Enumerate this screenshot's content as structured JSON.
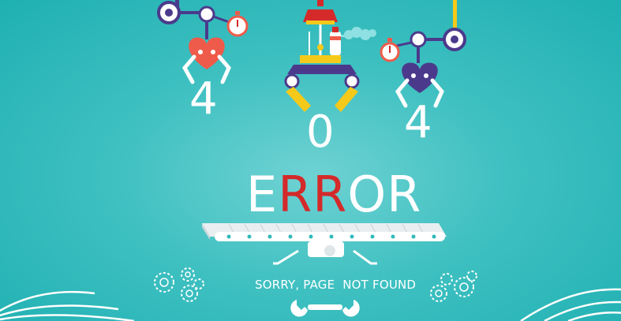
{
  "digits": {
    "first": "4",
    "second": "0",
    "third": "4"
  },
  "error_word": {
    "letters": [
      "E",
      "R",
      "R",
      "O",
      "R"
    ]
  },
  "message": "SORRY, PAGE  NOT FOUND",
  "colors": {
    "background": "#2fbabb",
    "white": "#ffffff",
    "red": "#d42a2a",
    "coral": "#ef5b4a",
    "purple": "#4b3a8c",
    "yellow": "#f5c91a",
    "track": "#e9eef0"
  },
  "icons": [
    "heart-icon",
    "stopwatch-icon",
    "wrench-icon",
    "gear-icon",
    "steam-icon"
  ]
}
